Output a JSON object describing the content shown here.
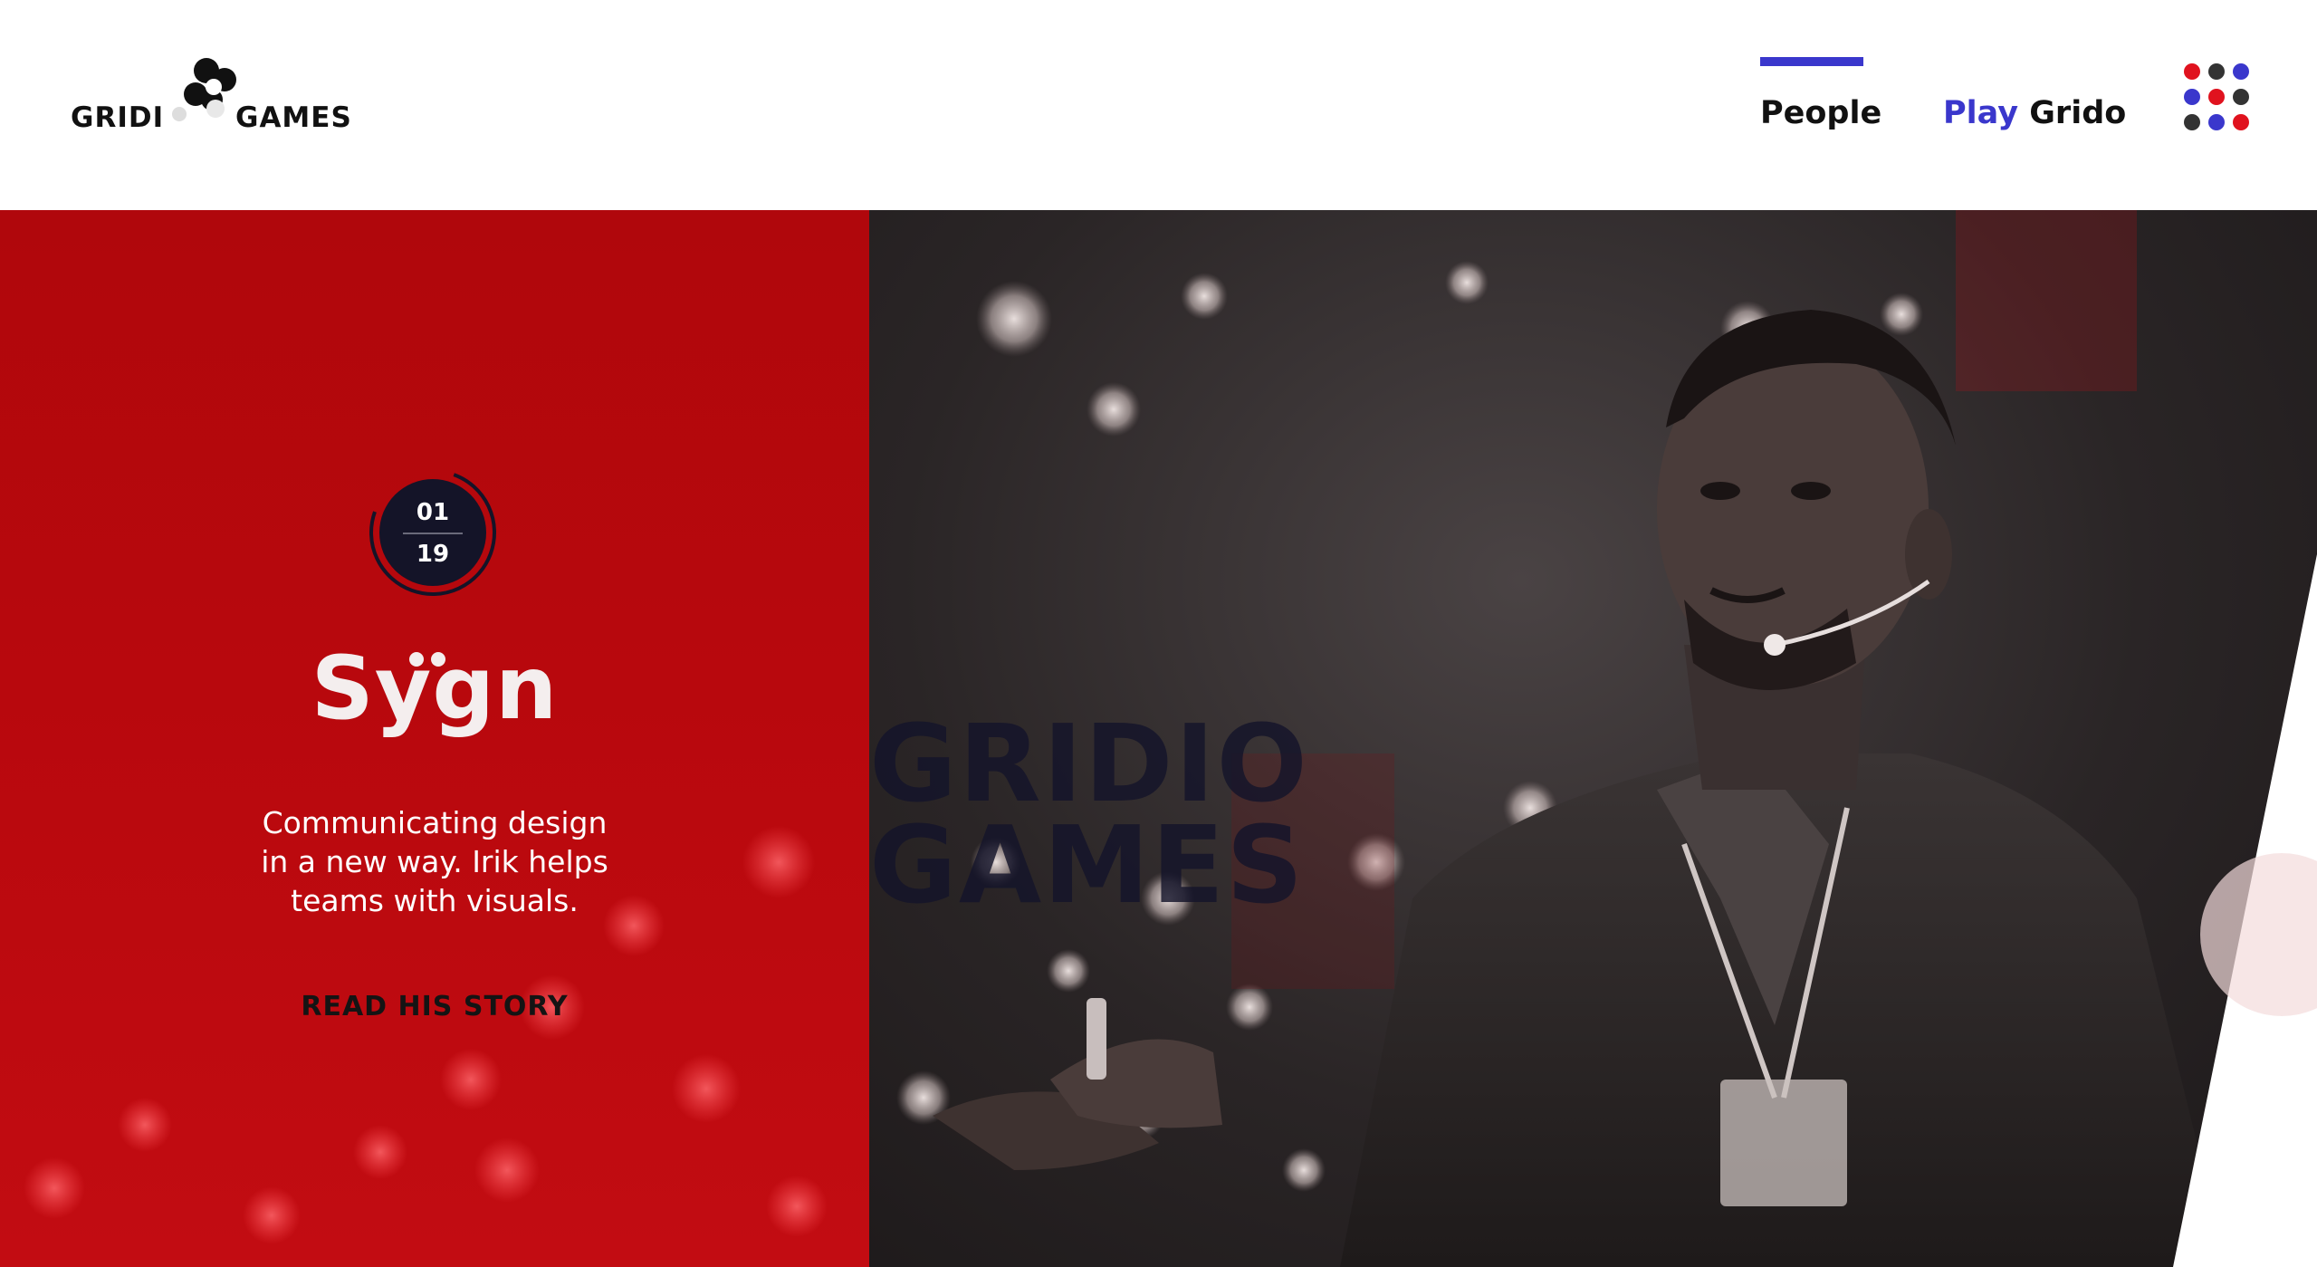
{
  "header": {
    "logo": {
      "left_word": "GRIDI",
      "right_word": "GAMES"
    },
    "nav": {
      "people_label": "People",
      "play_accent": "Play",
      "play_label": "Grido"
    },
    "menu_icon": "grid-dots-menu-icon"
  },
  "hero": {
    "counter": {
      "current": "01",
      "total": "19"
    },
    "brand_title": "Sygn",
    "description": [
      "Communicating design",
      "in a new way. Irik helps",
      "teams with visuals."
    ],
    "cta_label": "READ HIS STORY",
    "watermark": [
      "GRIDIO",
      "GAMES"
    ]
  },
  "colors": {
    "accent_blue": "#3a37cc",
    "brand_red": "#b8080d",
    "dark_navy": "#141428",
    "dot_red": "#e0121e"
  }
}
